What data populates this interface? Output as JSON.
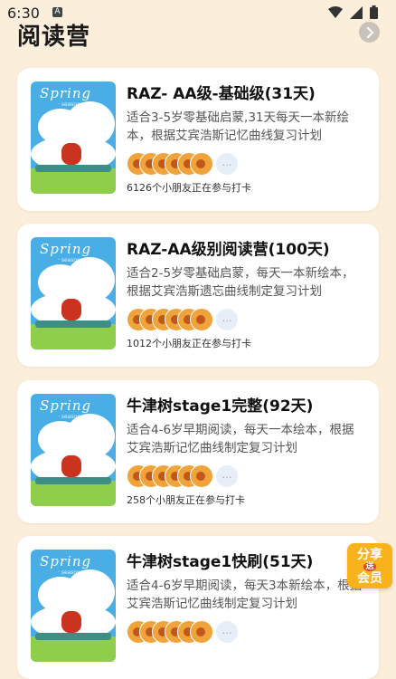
{
  "status_bar": {
    "time": "6:30",
    "app_icon_glyph": "A"
  },
  "header": {
    "title": "阅读营"
  },
  "camps": [
    {
      "title": "RAZ- AA级-基础级(31天)",
      "description": "适合3-5岁零基础启蒙,31天每天一本新绘本，根据艾宾浩斯记忆曲线复习计划",
      "participants": "6126个小朋友正在参与打卡"
    },
    {
      "title": "RAZ-AA级别阅读营(100天)",
      "description": "适合2-5岁零基础启蒙，每天一本新绘本，根据艾宾浩斯遗忘曲线制定复习计划",
      "participants": "1012个小朋友正在参与打卡"
    },
    {
      "title": "牛津树stage1完整(92天)",
      "description": "适合4-6岁早期阅读，每天一本绘本，根据艾宾浩斯记忆曲线制定复习计划",
      "participants": "258个小朋友正在参与打卡"
    },
    {
      "title": "牛津树stage1快刷(51天)",
      "description": "适合4-6岁早期阅读，每天3本新绘本，根据艾宾浩斯记忆曲线制定复习计划",
      "participants": ""
    }
  ],
  "cover": {
    "title": "Spring",
    "subtitle": "· season ·"
  },
  "share_badge": {
    "line1": "分享",
    "middle": "送",
    "line2": "会员"
  }
}
